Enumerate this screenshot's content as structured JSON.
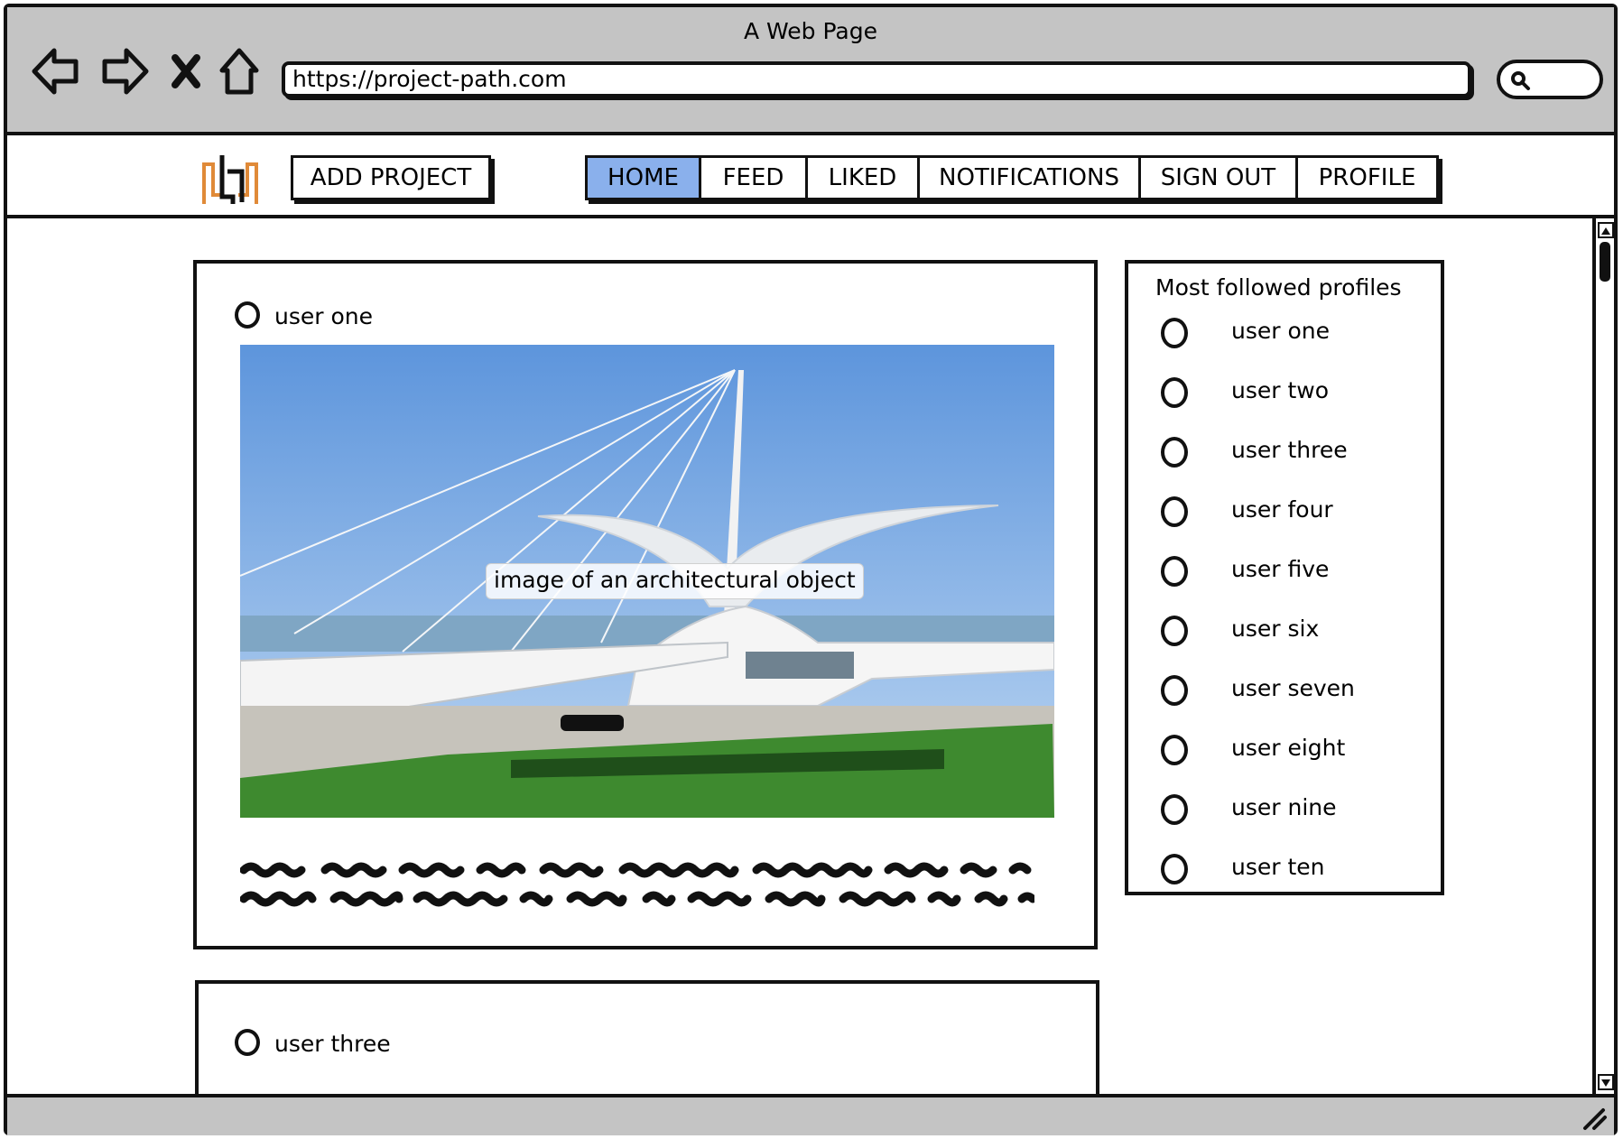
{
  "window": {
    "title": "A Web Page"
  },
  "browser": {
    "url": "https://project-path.com",
    "back_icon": "back-arrow-icon",
    "forward_icon": "forward-arrow-icon",
    "stop_icon": "close-x-icon",
    "home_icon": "home-icon",
    "search_icon": "search-icon"
  },
  "header": {
    "logo_icon": "project-logo-icon",
    "add_project_label": "ADD PROJECT",
    "tabs": [
      {
        "label": "HOME",
        "active": true
      },
      {
        "label": "FEED",
        "active": false
      },
      {
        "label": "LIKED",
        "active": false
      },
      {
        "label": "NOTIFICATIONS",
        "active": false
      },
      {
        "label": "SIGN OUT",
        "active": false
      },
      {
        "label": "PROFILE",
        "active": false
      }
    ],
    "active_color": "#8ab0ec"
  },
  "feed": {
    "posts": [
      {
        "user": "user one",
        "image_caption": "image of an architectural object"
      },
      {
        "user": "user three"
      }
    ]
  },
  "sidebar": {
    "title": "Most followed profiles",
    "profiles": [
      "user one",
      "user two",
      "user three",
      "user four",
      "user five",
      "user six",
      "user seven",
      "user eight",
      "user nine",
      "user ten"
    ]
  }
}
